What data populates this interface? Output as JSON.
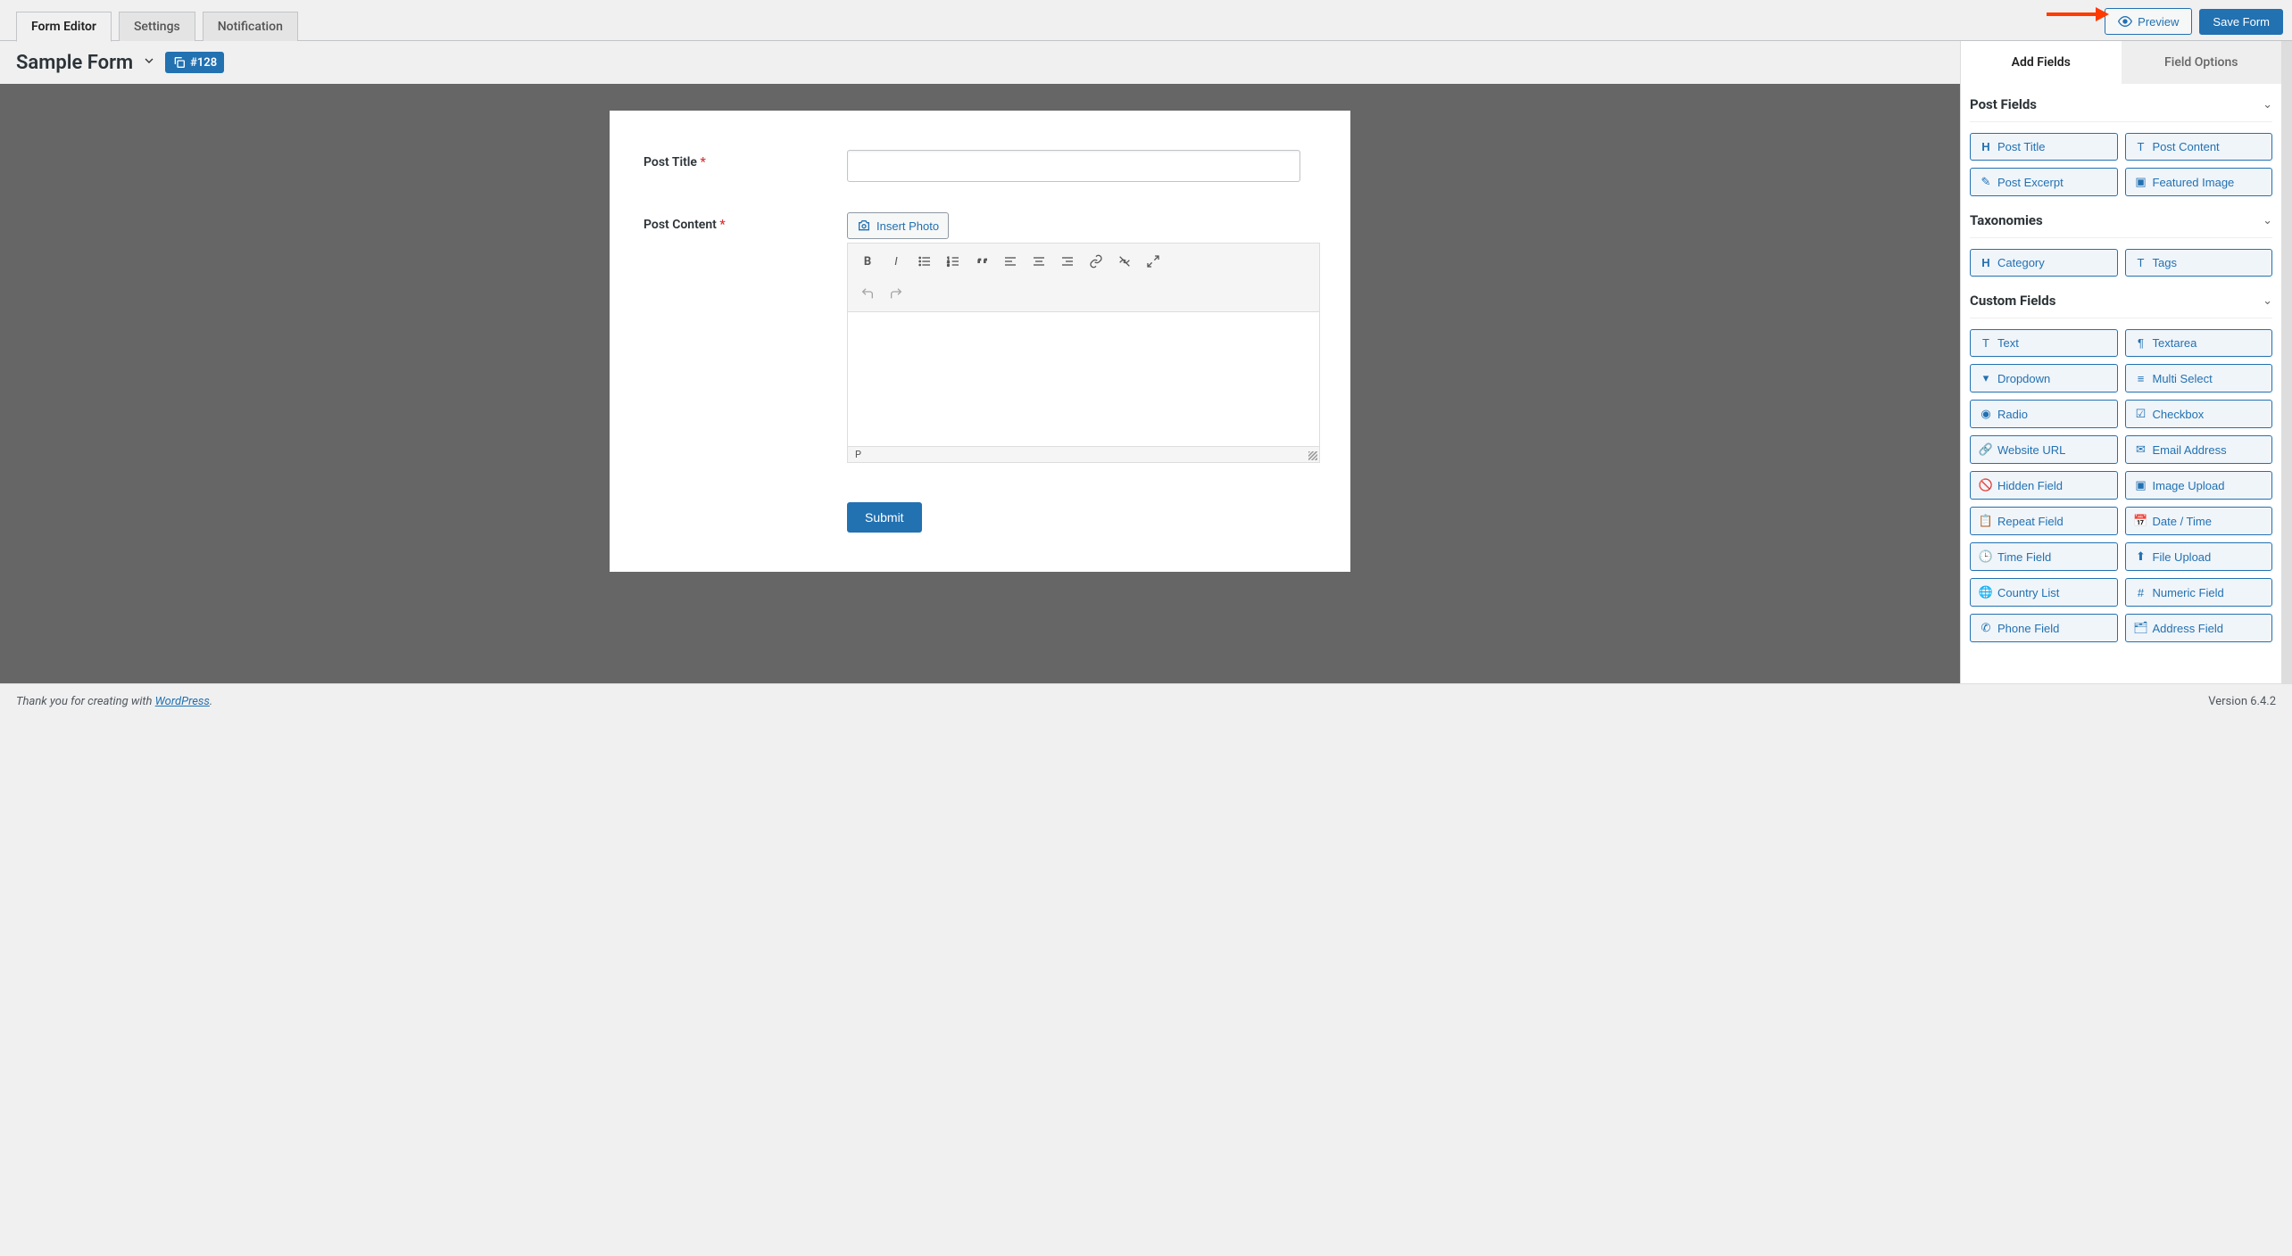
{
  "tabs": {
    "form_editor": "Form Editor",
    "settings": "Settings",
    "notification": "Notification"
  },
  "actions": {
    "preview": "Preview",
    "save": "Save Form"
  },
  "form": {
    "name": "Sample Form",
    "id_label": "#128"
  },
  "fields": {
    "post_title": {
      "label": "Post Title"
    },
    "post_content": {
      "label": "Post Content"
    }
  },
  "editor": {
    "insert_photo": "Insert Photo",
    "status_path": "P"
  },
  "submit_label": "Submit",
  "panel_tabs": {
    "add": "Add Fields",
    "options": "Field Options"
  },
  "groups": {
    "post": {
      "title": "Post Fields",
      "items": [
        "Post Title",
        "Post Content",
        "Post Excerpt",
        "Featured Image"
      ]
    },
    "tax": {
      "title": "Taxonomies",
      "items": [
        "Category",
        "Tags"
      ]
    },
    "custom": {
      "title": "Custom Fields",
      "items": [
        "Text",
        "Textarea",
        "Dropdown",
        "Multi Select",
        "Radio",
        "Checkbox",
        "Website URL",
        "Email Address",
        "Hidden Field",
        "Image Upload",
        "Repeat Field",
        "Date / Time",
        "Time Field",
        "File Upload",
        "Country List",
        "Numeric Field",
        "Phone Field",
        "Address Field"
      ]
    }
  },
  "footer": {
    "thanks_prefix": "Thank you for creating with ",
    "thanks_linktext": "WordPress",
    "version": "Version 6.4.2"
  }
}
